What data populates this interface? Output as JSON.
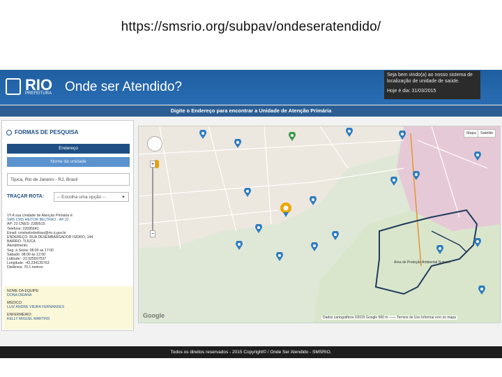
{
  "slide": {
    "url": "https://smsrio.org/subpav/ondeseratendido/"
  },
  "header": {
    "logo_text": "RIO",
    "logo_sub": "PREFEITURA",
    "title": "Onde ser Atendido?",
    "welcome_line1": "Seja bem vindo(a) ao nosso sistema de",
    "welcome_line2": "localização de unidade de saúde.",
    "date": "Hoje é dia: 31/03/2015"
  },
  "banner": {
    "text": "Digite o Endereço para encontrar a Unidade de Atenção Primária"
  },
  "sidebar": {
    "heading": "FORMAS DE PESQUISA",
    "tab_address": "Endereço",
    "tab_unit": "Nome da unidade",
    "address_value": "Tijuca, Rio de Janeiro - RJ, Brasil",
    "route_label": "TRAÇAR ROTA:",
    "route_select": "-- Escolha uma opção --",
    "result_lines": [
      "1ª/ A sua Unidade de Atenção Primária é:",
      "SMS CMS HEITOR BELTRÃO - AP 22",
      "AP: 22 CNES: 2280515",
      "Telefone: 22695642",
      "Email: cmsheitorbeltrao@rio.rj.gov.br",
      "ENDEREÇO: RUA DESEMBARGADOR ISIDRO, 144",
      "BAIRRO: TIJUCA",
      "Atendimento:",
      "Seg. à Sexta: 08:00 as 17:00",
      "Sábado: 08:00 às 12:00",
      "Latitude: -22.925507537",
      "Longitude: -43.234135763",
      "Distância: 70.1 metros"
    ],
    "team_label": "NOME DA EQUIPE:",
    "team_value": "DONA DIEANA",
    "doctor_label": "MÉDICO:",
    "doctor_value": "LUIZ ANDRE VIEIRA FERNANDES",
    "nurse_label": "ENFERMEIRO:",
    "nurse_value": "KELLY MIGUEL MARTINS"
  },
  "map": {
    "type_map": "Mapa",
    "type_satellite": "Satélite",
    "zoom_in": "+",
    "zoom_out": "−",
    "google": "Google",
    "attribution": "Dados cartográficos ©2015 Google  500 m ——  Termos de Uso  Informar erro no mapa",
    "area_label": "Área de Proteção Ambiental Sumaré",
    "colors": {
      "land": "#dfe8d6",
      "urban": "#ece7df",
      "pink_zone": "#e6c9d6",
      "route": "#1f3a5c",
      "pin": "#2f7dbf"
    },
    "pins": [
      "health-pin",
      "health-pin",
      "health-pin",
      "health-pin",
      "health-pin",
      "health-pin",
      "health-pin",
      "health-pin",
      "health-pin",
      "health-pin",
      "health-pin",
      "health-pin",
      "health-pin",
      "health-pin",
      "health-pin",
      "health-pin",
      "health-pin",
      "health-pin"
    ]
  },
  "footer": {
    "text": "Todos os direitos reservados - 2015 Copyright© / Onde Ser Atendido - SMSRIO."
  }
}
